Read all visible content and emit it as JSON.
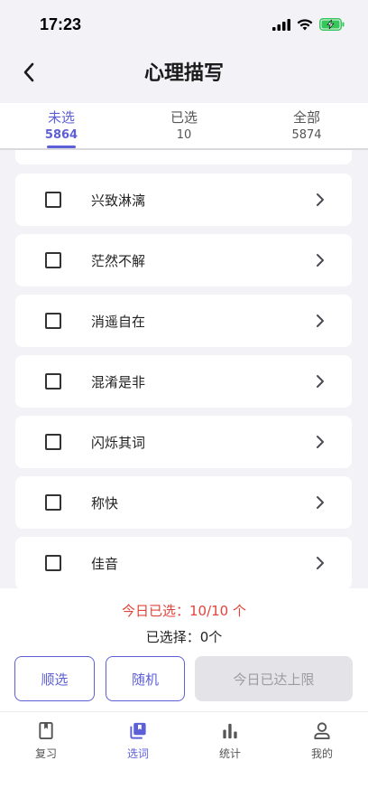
{
  "status_bar": {
    "time": "17:23"
  },
  "nav": {
    "title": "心理描写"
  },
  "tabs": [
    {
      "label": "未选",
      "count": "5864",
      "active": true
    },
    {
      "label": "已选",
      "count": "10",
      "active": false
    },
    {
      "label": "全部",
      "count": "5874",
      "active": false
    }
  ],
  "list": {
    "items": [
      {
        "label": "兴致淋漓"
      },
      {
        "label": "茫然不解"
      },
      {
        "label": "消遥自在"
      },
      {
        "label": "混淆是非"
      },
      {
        "label": "闪烁其词"
      },
      {
        "label": "称快"
      },
      {
        "label": "佳音"
      }
    ]
  },
  "bottom": {
    "daily_selected": "今日已选：10/10 个",
    "selected_count": "已选择：0个",
    "btn_sequential": "顺选",
    "btn_random": "随机",
    "btn_limit": "今日已达上限"
  },
  "tab_bar": {
    "items": [
      {
        "label": "复习",
        "icon": "book-icon"
      },
      {
        "label": "选词",
        "icon": "cards-icon",
        "active": true
      },
      {
        "label": "统计",
        "icon": "bar-chart-icon"
      },
      {
        "label": "我的",
        "icon": "person-icon"
      }
    ]
  },
  "colors": {
    "accent": "#5d5fd6",
    "warning": "#e0443a",
    "battery": "#34c759"
  }
}
